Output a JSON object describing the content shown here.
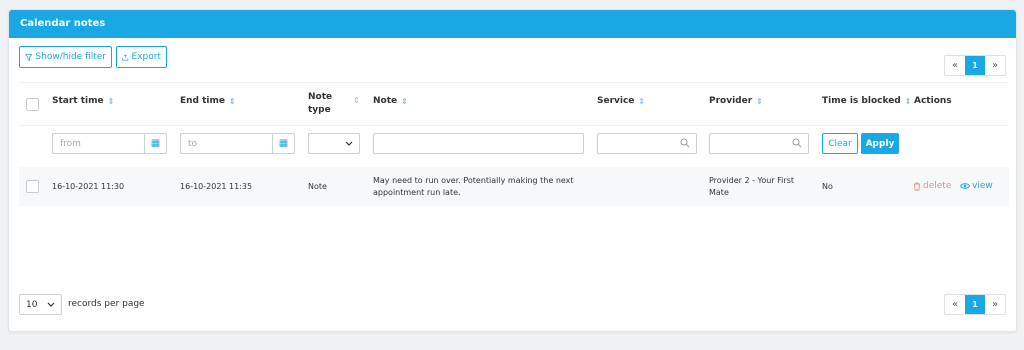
{
  "panel": {
    "title": "Calendar notes"
  },
  "toolbar": {
    "filter_label": "Show/hide filter",
    "export_label": "Export"
  },
  "pagination": {
    "prev": "«",
    "current": "1",
    "next": "»"
  },
  "columns": {
    "start_time": "Start time",
    "end_time": "End time",
    "note_type_line1": "Note",
    "note_type_line2": "type",
    "note": "Note",
    "service": "Service",
    "provider": "Provider",
    "time_blocked": "Time is blocked",
    "actions": "Actions"
  },
  "filters": {
    "from_placeholder": "from",
    "to_placeholder": "to",
    "clear_label": "Clear",
    "apply_label": "Apply"
  },
  "rows": [
    {
      "start_time": "16-10-2021 11:30",
      "end_time": "16-10-2021 11:35",
      "note_type": "Note",
      "note": "May need to run over. Potentially making the next appointment run late.",
      "service": "",
      "provider": "Provider 2 - Your First Mate",
      "time_blocked": "No",
      "delete_label": "delete",
      "view_label": "view"
    }
  ],
  "footer": {
    "page_size": "10",
    "records_label": "records per page"
  },
  "colors": {
    "accent": "#1aa8e4",
    "delete": "#f08a8a"
  }
}
